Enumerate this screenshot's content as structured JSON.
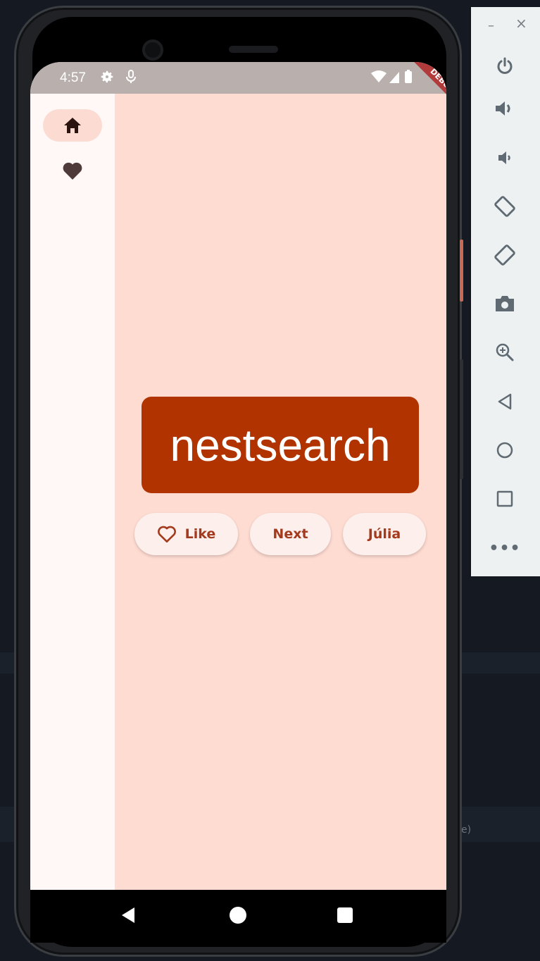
{
  "status_bar": {
    "time": "4:57"
  },
  "debug_banner": "DEBUG",
  "nav_rail": [
    {
      "id": "home",
      "label": "Home",
      "selected": true
    },
    {
      "id": "favorites",
      "label": "Favorites",
      "selected": false
    }
  ],
  "word_card": {
    "text": "nestsearch"
  },
  "buttons": {
    "like": "Like",
    "next": "Next",
    "user": "Júlia"
  },
  "emulator_toolbar": {
    "minimize": "–",
    "close": "×",
    "more": "•••",
    "items": [
      "power-icon",
      "volume-up-icon",
      "volume-down-icon",
      "rotate-left-icon",
      "rotate-right-icon",
      "camera-icon",
      "zoom-icon",
      "back-icon",
      "home-icon",
      "overview-icon",
      "more-icon"
    ]
  },
  "background_hint": "e)",
  "colors": {
    "screen_bg": "#ffdcd2",
    "rail_bg": "#fff8f7",
    "card_bg": "#b13400",
    "button_text": "#a43a1d",
    "status_bar": "#b9b0ad"
  }
}
